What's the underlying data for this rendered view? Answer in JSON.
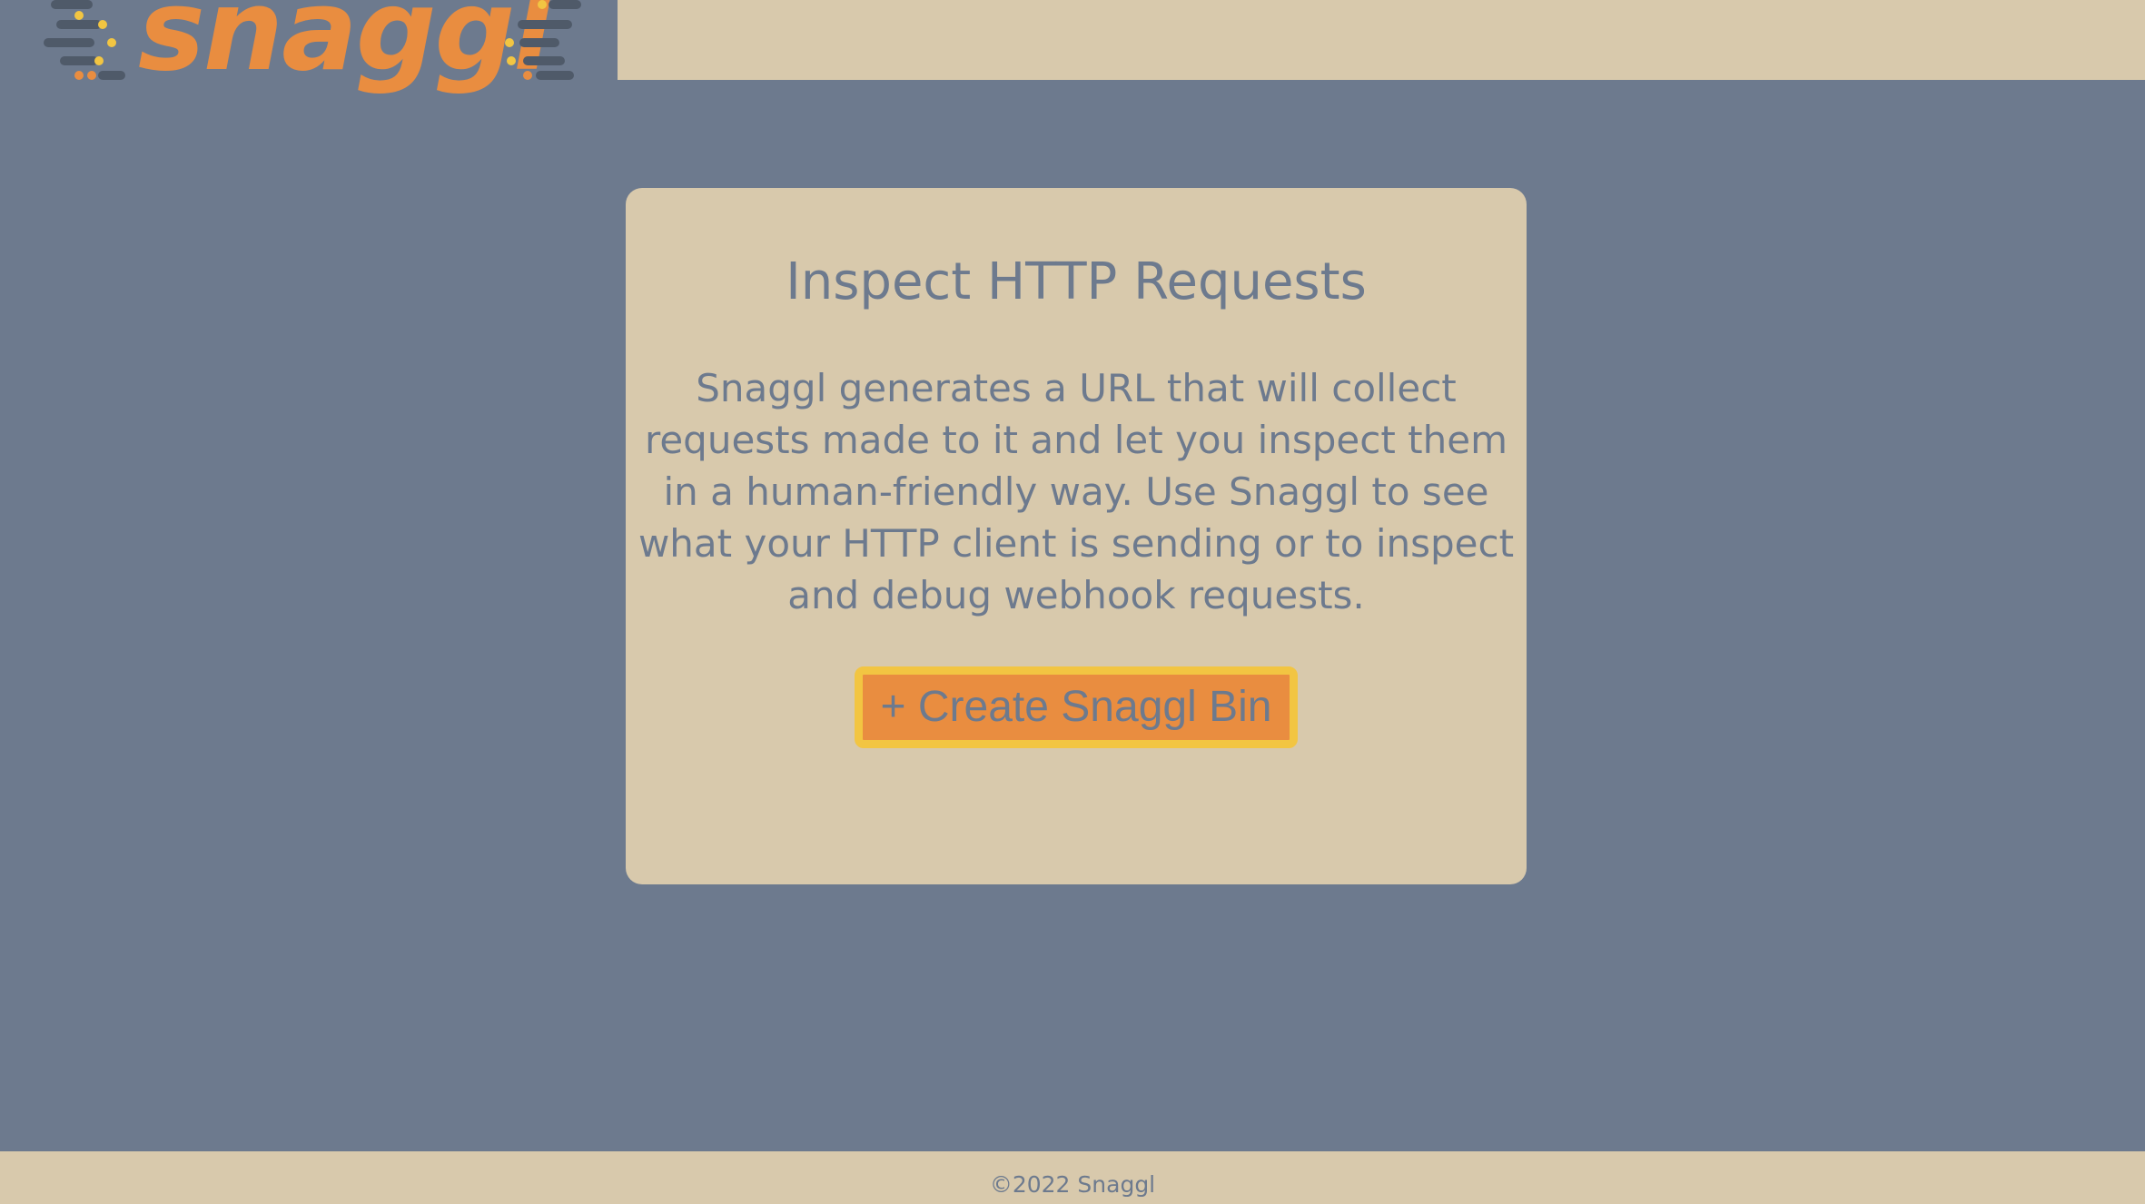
{
  "header": {
    "logo_text": "snaggl"
  },
  "card": {
    "title": "Inspect HTTP Requests",
    "description": "Snaggl generates a URL that will collect requests made to it and let you inspect them in a human-friendly way. Use Snaggl to see what your HTTP client is sending or to inspect and debug webhook requests.",
    "create_button_label": "+ Create Snaggl Bin"
  },
  "footer": {
    "copyright": "©2022 Snaggl"
  },
  "colors": {
    "background": "#6d7a8e",
    "panel": "#d8c9ac",
    "accent_orange": "#e98d40",
    "accent_yellow": "#f2c542",
    "text": "#6d7a8e"
  },
  "icons": {
    "logo_left_decoration": "speed-lines-icon",
    "logo_right_decoration": "speed-lines-icon"
  }
}
